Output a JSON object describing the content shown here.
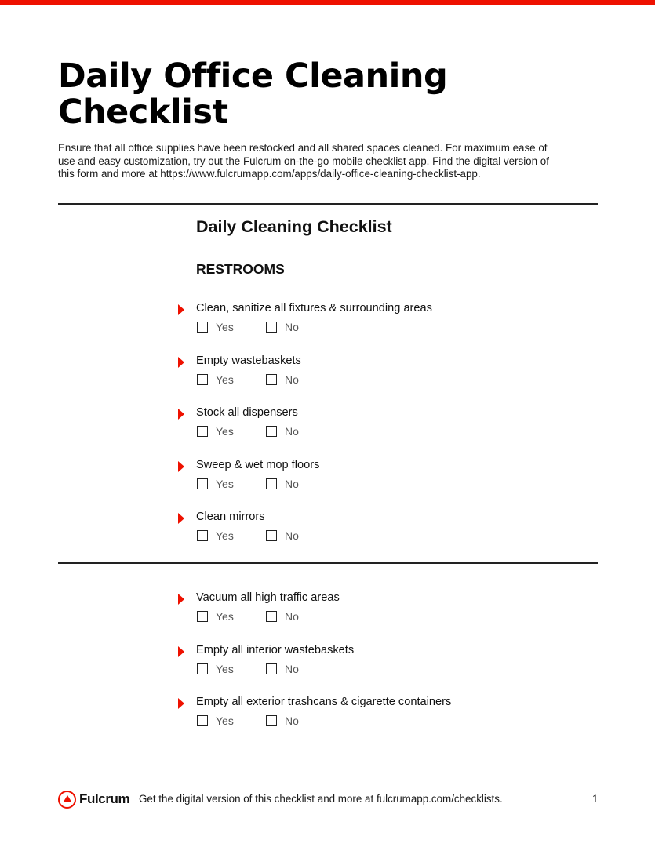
{
  "colors": {
    "accent": "#ee1100",
    "text": "#111111",
    "option_text": "#555555"
  },
  "document": {
    "title_line1": "Daily Office Cleaning",
    "title_line2": "Checklist",
    "intro_text": "Ensure that all office supplies have been restocked and all shared spaces cleaned. For maximum ease of use and easy customization, try out the Fulcrum on-the-go mobile checklist app. Find the digital version of this form and more at ",
    "intro_link": "https://www.fulcrumapp.com/apps/daily-office-cleaning-checklist-app",
    "intro_end": "."
  },
  "checklist": {
    "title": "Daily Cleaning Checklist",
    "section": "RESTROOMS",
    "options": {
      "yes": "Yes",
      "no": "No"
    },
    "items": [
      {
        "label": "Clean, sanitize all fixtures & surrounding areas",
        "yes_checked": false,
        "no_checked": false
      },
      {
        "label": "Empty wastebaskets",
        "yes_checked": false,
        "no_checked": false
      },
      {
        "label": "Stock all dispensers",
        "yes_checked": false,
        "no_checked": false
      },
      {
        "label": "Sweep & wet mop floors",
        "yes_checked": false,
        "no_checked": false
      },
      {
        "label": "Clean mirrors",
        "yes_checked": false,
        "no_checked": false
      },
      {
        "label": "Vacuum all high traffic areas",
        "yes_checked": false,
        "no_checked": false
      },
      {
        "label": "Empty all interior wastebaskets",
        "yes_checked": false,
        "no_checked": false
      },
      {
        "label": "Empty all exterior trashcans & cigarette containers",
        "yes_checked": false,
        "no_checked": false
      }
    ]
  },
  "footer": {
    "logo_text": "Fulcrum",
    "text": "Get the digital version of this checklist and more at ",
    "link": "fulcrumapp.com/checklists",
    "text_end": ".",
    "page_number": "1"
  }
}
